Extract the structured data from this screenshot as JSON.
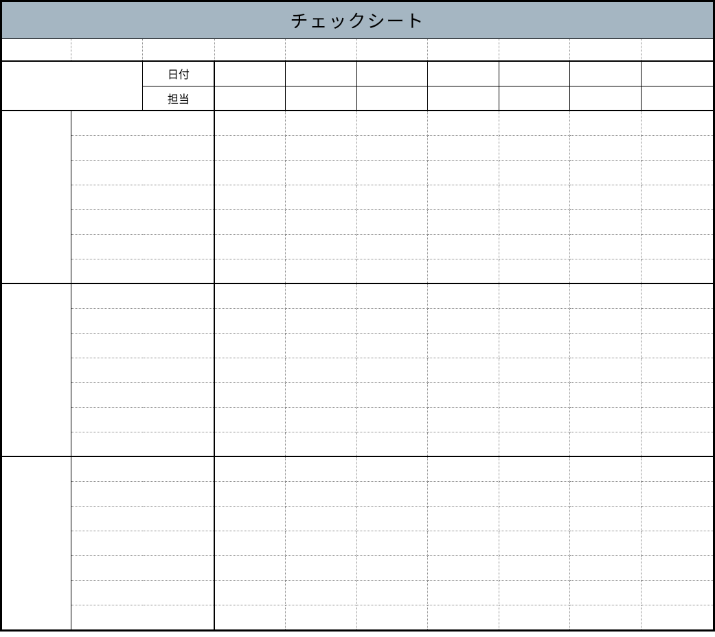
{
  "title": "チェックシート",
  "header": {
    "row1_label": "日付",
    "row2_label": "担当",
    "date_cells": [
      "",
      "",
      "",
      "",
      "",
      "",
      ""
    ],
    "person_cells": [
      "",
      "",
      "",
      "",
      "",
      "",
      ""
    ]
  },
  "sections": [
    {
      "category": "",
      "rows": [
        {
          "item": "",
          "cells": [
            "",
            "",
            "",
            "",
            "",
            "",
            ""
          ]
        },
        {
          "item": "",
          "cells": [
            "",
            "",
            "",
            "",
            "",
            "",
            ""
          ]
        },
        {
          "item": "",
          "cells": [
            "",
            "",
            "",
            "",
            "",
            "",
            ""
          ]
        },
        {
          "item": "",
          "cells": [
            "",
            "",
            "",
            "",
            "",
            "",
            ""
          ]
        },
        {
          "item": "",
          "cells": [
            "",
            "",
            "",
            "",
            "",
            "",
            ""
          ]
        },
        {
          "item": "",
          "cells": [
            "",
            "",
            "",
            "",
            "",
            "",
            ""
          ]
        },
        {
          "item": "",
          "cells": [
            "",
            "",
            "",
            "",
            "",
            "",
            ""
          ]
        }
      ]
    },
    {
      "category": "",
      "rows": [
        {
          "item": "",
          "cells": [
            "",
            "",
            "",
            "",
            "",
            "",
            ""
          ]
        },
        {
          "item": "",
          "cells": [
            "",
            "",
            "",
            "",
            "",
            "",
            ""
          ]
        },
        {
          "item": "",
          "cells": [
            "",
            "",
            "",
            "",
            "",
            "",
            ""
          ]
        },
        {
          "item": "",
          "cells": [
            "",
            "",
            "",
            "",
            "",
            "",
            ""
          ]
        },
        {
          "item": "",
          "cells": [
            "",
            "",
            "",
            "",
            "",
            "",
            ""
          ]
        },
        {
          "item": "",
          "cells": [
            "",
            "",
            "",
            "",
            "",
            "",
            ""
          ]
        },
        {
          "item": "",
          "cells": [
            "",
            "",
            "",
            "",
            "",
            "",
            ""
          ]
        }
      ]
    },
    {
      "category": "",
      "rows": [
        {
          "item": "",
          "cells": [
            "",
            "",
            "",
            "",
            "",
            "",
            ""
          ]
        },
        {
          "item": "",
          "cells": [
            "",
            "",
            "",
            "",
            "",
            "",
            ""
          ]
        },
        {
          "item": "",
          "cells": [
            "",
            "",
            "",
            "",
            "",
            "",
            ""
          ]
        },
        {
          "item": "",
          "cells": [
            "",
            "",
            "",
            "",
            "",
            "",
            ""
          ]
        },
        {
          "item": "",
          "cells": [
            "",
            "",
            "",
            "",
            "",
            "",
            ""
          ]
        },
        {
          "item": "",
          "cells": [
            "",
            "",
            "",
            "",
            "",
            "",
            ""
          ]
        },
        {
          "item": "",
          "cells": [
            "",
            "",
            "",
            "",
            "",
            "",
            ""
          ]
        }
      ]
    }
  ]
}
